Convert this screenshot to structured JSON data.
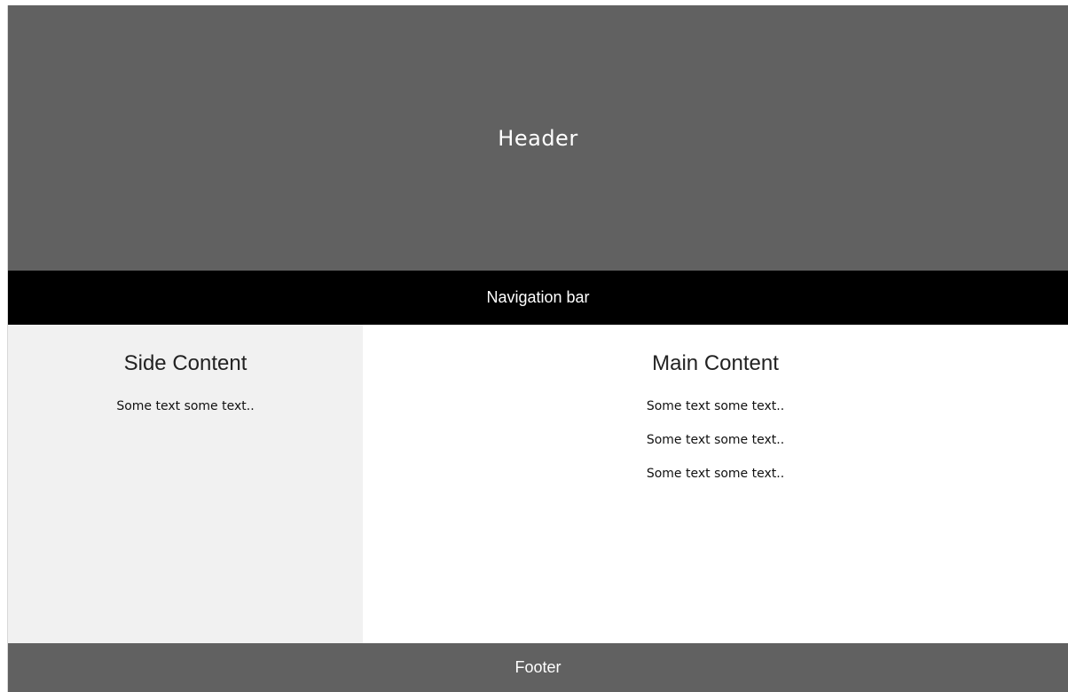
{
  "header": {
    "title": "Header"
  },
  "navbar": {
    "label": "Navigation bar"
  },
  "side": {
    "title": "Side Content",
    "paragraphs": [
      "Some text some text.."
    ]
  },
  "main": {
    "title": "Main Content",
    "paragraphs": [
      "Some text some text..",
      "Some text some text..",
      "Some text some text.."
    ]
  },
  "footer": {
    "label": "Footer"
  },
  "colors": {
    "header_bg": "#616161",
    "navbar_bg": "#000000",
    "side_bg": "#f1f1f1",
    "main_bg": "#ffffff",
    "footer_bg": "#616161"
  }
}
